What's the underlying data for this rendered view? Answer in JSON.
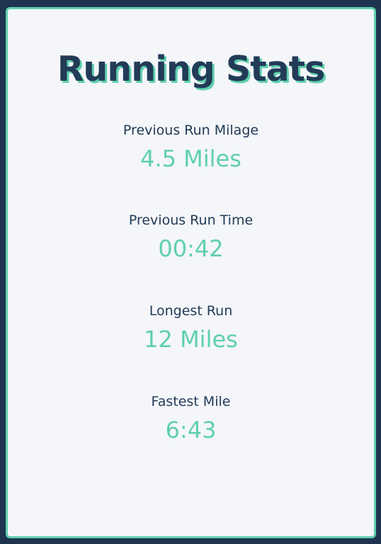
{
  "title": "Running Stats",
  "stats": [
    {
      "label": "Previous Run Milage",
      "value": "4.5 Miles"
    },
    {
      "label": "Previous Run Time",
      "value": "00:42"
    },
    {
      "label": "Longest Run",
      "value": "12 Miles"
    },
    {
      "label": "Fastest Mile",
      "value": "6:43"
    }
  ],
  "colors": {
    "background": "#1e3450",
    "card": "#f4f6f9",
    "accent": "#5fcfae",
    "text": "#223b57"
  }
}
